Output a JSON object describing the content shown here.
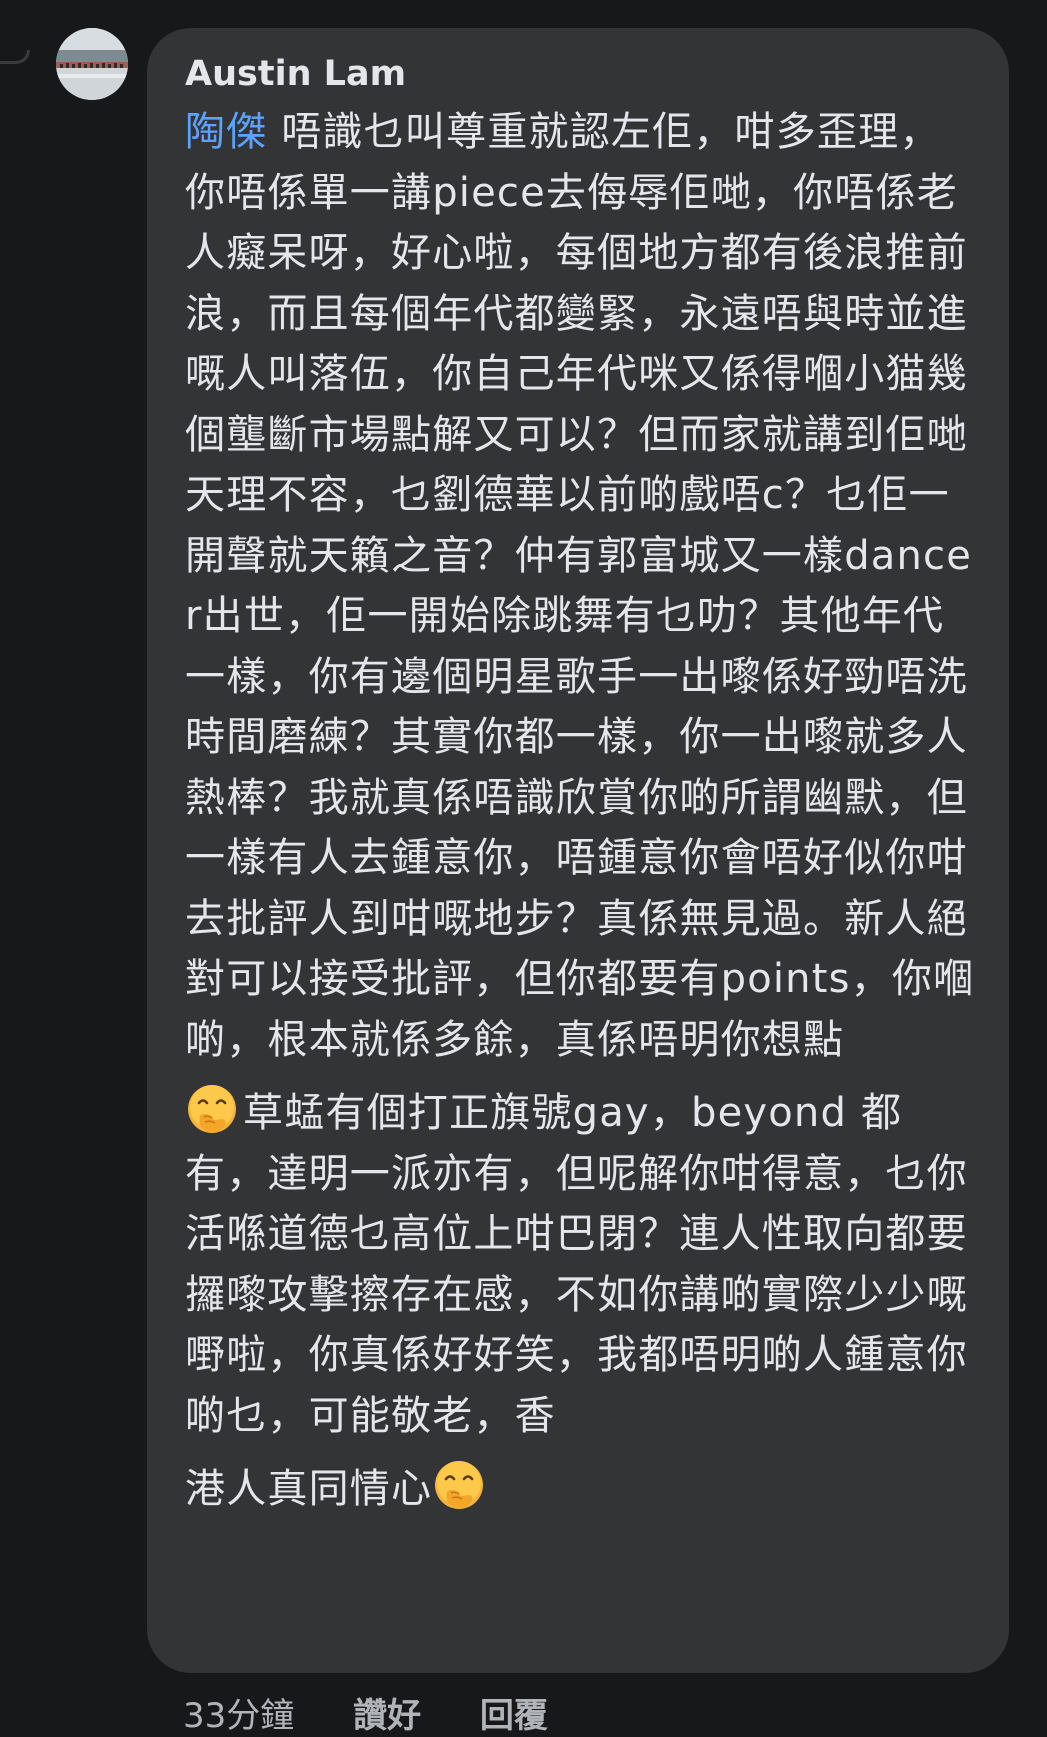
{
  "comment": {
    "author": "Austin Lam",
    "mention": "陶傑",
    "paragraph_1": " 唔識乜叫尊重就認左佢，咁多歪理，你唔係單一講piece去侮辱佢哋，你唔係老人癡呆呀，好心啦，每個地方都有後浪推前浪，而且每個年代都變緊，永遠唔與時並進嘅人叫落伍，你自己年代咪又係得嗰小猫幾個壟斷市場點解又可以？但而家就講到佢哋天理不容，乜劉德華以前啲戲唔c？乜佢一開聲就天籟之音？仲有郭富城又一樣dancer出世，佢一開始除跳舞有乜叻？其他年代一樣，你有邊個明星歌手一出嚟係好勁唔洗時間磨練？其實你都一樣，你一出嚟就多人熱棒？我就真係唔識欣賞你啲所謂幽默，但一樣有人去鍾意你，唔鍾意你會唔好似你咁去批評人到咁嘅地步？真係無見過。新人絕對可以接受批評，但你都要有points，你嗰啲，根本就係多餘，真係唔明你想點",
    "paragraph_2": "草蜢有個打正旗號gay，beyond 都有，達明一派亦有，但呢解你咁得意，乜你活喺道德乜高位上咁巴閉？連人性取向都要攞嚟攻擊擦存在感，不如你講啲實際少少嘅嘢啦，你真係好好笑，我都唔明啲人鍾意你啲乜，可能敬老，香",
    "paragraph_3": "港人真同情心",
    "emoji_1": "face-with-hand-over-mouth",
    "emoji_2": "face-with-hand-over-mouth"
  },
  "actions": {
    "time": "33分鐘",
    "like": "讚好",
    "reply": "回覆"
  }
}
